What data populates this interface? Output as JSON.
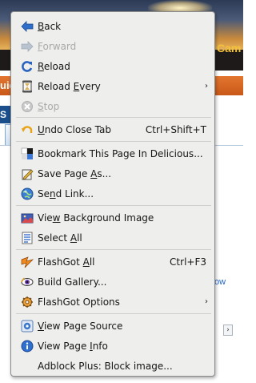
{
  "background": {
    "header_text": "Cam",
    "orange_bar_text": "uid",
    "blue_box_text": "S",
    "link_text": "ow",
    "scroll_arrow": "›"
  },
  "menu": {
    "items": [
      {
        "id": "back",
        "pre": "",
        "key": "B",
        "post": "ack",
        "shortcut": "",
        "submenu": false,
        "disabled": false,
        "icon": "back-arrow-icon"
      },
      {
        "id": "forward",
        "pre": "",
        "key": "F",
        "post": "orward",
        "shortcut": "",
        "submenu": false,
        "disabled": true,
        "icon": "forward-arrow-icon"
      },
      {
        "id": "reload",
        "pre": "",
        "key": "R",
        "post": "eload",
        "shortcut": "",
        "submenu": false,
        "disabled": false,
        "icon": "reload-icon"
      },
      {
        "id": "reload-every",
        "pre": "Reload ",
        "key": "E",
        "post": "very",
        "shortcut": "",
        "submenu": true,
        "disabled": false,
        "icon": "reload-every-icon"
      },
      {
        "id": "stop",
        "pre": "",
        "key": "S",
        "post": "top",
        "shortcut": "",
        "submenu": false,
        "disabled": true,
        "icon": "stop-icon"
      },
      {
        "id": "undo-close-tab",
        "pre": "",
        "key": "U",
        "post": "ndo Close Tab",
        "shortcut": "Ctrl+Shift+T",
        "submenu": false,
        "disabled": false,
        "icon": "undo-icon"
      },
      {
        "id": "bookmark-delicious",
        "pre": "Bookmark This Page In Delicious...",
        "key": "",
        "post": "",
        "shortcut": "",
        "submenu": false,
        "disabled": false,
        "icon": "delicious-icon"
      },
      {
        "id": "save-page-as",
        "pre": "Save Page ",
        "key": "A",
        "post": "s...",
        "shortcut": "",
        "submenu": false,
        "disabled": false,
        "icon": "save-icon"
      },
      {
        "id": "send-link",
        "pre": "Se",
        "key": "n",
        "post": "d Link...",
        "shortcut": "",
        "submenu": false,
        "disabled": false,
        "icon": "globe-icon"
      },
      {
        "id": "view-background-image",
        "pre": "Vie",
        "key": "w",
        "post": " Background Image",
        "shortcut": "",
        "submenu": false,
        "disabled": false,
        "icon": "image-icon"
      },
      {
        "id": "select-all",
        "pre": "Select ",
        "key": "A",
        "post": "ll",
        "shortcut": "",
        "submenu": false,
        "disabled": false,
        "icon": "select-all-icon"
      },
      {
        "id": "flashgot-all",
        "pre": "FlashGot ",
        "key": "A",
        "post": "ll",
        "shortcut": "Ctrl+F3",
        "submenu": false,
        "disabled": false,
        "icon": "flashgot-icon"
      },
      {
        "id": "build-gallery",
        "pre": "Build Gallery...",
        "key": "",
        "post": "",
        "shortcut": "",
        "submenu": false,
        "disabled": false,
        "icon": "gallery-eye-icon"
      },
      {
        "id": "flashgot-options",
        "pre": "FlashGot Options",
        "key": "",
        "post": "",
        "shortcut": "",
        "submenu": true,
        "disabled": false,
        "icon": "flashgot-options-icon"
      },
      {
        "id": "view-page-source",
        "pre": "",
        "key": "V",
        "post": "iew Page Source",
        "shortcut": "",
        "submenu": false,
        "disabled": false,
        "icon": "page-source-icon"
      },
      {
        "id": "view-page-info",
        "pre": "View Page ",
        "key": "I",
        "post": "nfo",
        "shortcut": "",
        "submenu": false,
        "disabled": false,
        "icon": "info-icon"
      },
      {
        "id": "adblock-block-image",
        "pre": "Adblock Plus: Block image...",
        "key": "",
        "post": "",
        "shortcut": "",
        "submenu": false,
        "disabled": false,
        "icon": ""
      }
    ],
    "submenu_arrow": "›",
    "colors": {
      "menu_bg": "#eeeeec",
      "disabled": "#a9a9a9",
      "text": "#151515"
    }
  }
}
